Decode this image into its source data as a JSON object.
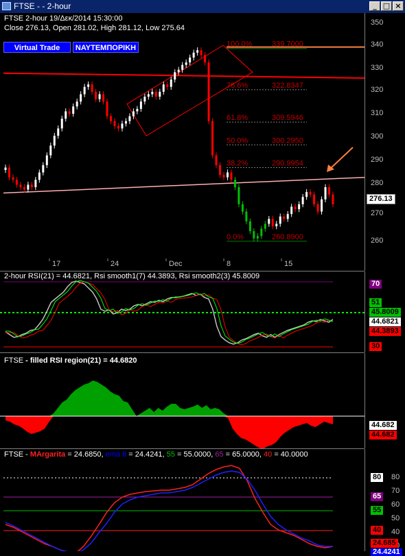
{
  "window": {
    "title": "FTSE -  - 2-hour",
    "min_label": "_",
    "max_label": "□",
    "close_label": "×"
  },
  "main_pane": {
    "header_line1": "FTSE  2-hour  19/Δεκ/2014 15:30:00",
    "header_line2": "Close 276.13, Open 281.02, High 281.12, Low 275.64",
    "buttons": [
      "Virtual Trade",
      "ΝΑΥΤΕΜΠΟΡΙΚΗ"
    ],
    "price_ticks": [
      "350",
      "340",
      "330",
      "320",
      "310",
      "300",
      "290",
      "280",
      "270",
      "260"
    ],
    "last_price": "276.13",
    "fib_levels": [
      {
        "pct": "100.0%",
        "value": "339.7000"
      },
      {
        "pct": "78.6%",
        "value": "322.8347"
      },
      {
        "pct": "61.8%",
        "value": "309.5946"
      },
      {
        "pct": "50.0%",
        "value": "300.2950"
      },
      {
        "pct": "38.2%",
        "value": "290.9954"
      },
      {
        "pct": "0.0%",
        "value": "260.8900"
      }
    ],
    "date_labels": [
      "17",
      "24",
      "Dec",
      "8",
      "15"
    ],
    "colors": {
      "up": "#ffffff",
      "down": "#ff0000",
      "fib": "#c00000",
      "channel": "#ff0000",
      "support": "#ffb0b0",
      "arrow": "#ff8040",
      "top_line": "#ff8040"
    }
  },
  "rsi_pane": {
    "header": "2-hour RSI(21) = 44.6821, Rsi smooth1(7) 44.3893, Rsi smooth2(3) 45.8009",
    "badges": [
      {
        "text": "70",
        "bg": "#800080",
        "fg": "#ffffff"
      },
      {
        "text": "51",
        "bg": "#00c000",
        "fg": "#000000"
      },
      {
        "text": "45.8009",
        "bg": "#00c000",
        "fg": "#000000"
      },
      {
        "text": "44.6821",
        "bg": "#ffffff",
        "fg": "#000000"
      },
      {
        "text": "44.3893",
        "bg": "#ff0000",
        "fg": "#000000"
      },
      {
        "text": "30",
        "bg": "#ff0000",
        "fg": "#000000"
      }
    ]
  },
  "filled_pane": {
    "header_name": "FTSE",
    "header_rest": " - filled RSI region(21) = 44.6820",
    "badges": [
      {
        "text": "44.682",
        "bg": "#ffffff",
        "fg": "#000000"
      },
      {
        "text": "44.682",
        "bg": "#ff0000",
        "fg": "#000000"
      }
    ]
  },
  "margarita_pane": {
    "header_parts": [
      {
        "text": "FTSE",
        "color": "#ffffff"
      },
      {
        "text": " - ",
        "color": "#ffffff"
      },
      {
        "text": "MArgarita",
        "color": "#ff2020"
      },
      {
        "text": " = 24.6850, ",
        "color": "#ffffff"
      },
      {
        "text": "ema 8",
        "color": "#0000ff"
      },
      {
        "text": " = 24.4241, ",
        "color": "#ffffff"
      },
      {
        "text": "55",
        "color": "#00c000"
      },
      {
        "text": " = 55.0000, ",
        "color": "#ffffff"
      },
      {
        "text": "65",
        "color": "#a020a0"
      },
      {
        "text": " = 65.0000, ",
        "color": "#ffffff"
      },
      {
        "text": "40",
        "color": "#ff2020"
      },
      {
        "text": " = 40.0000",
        "color": "#ffffff"
      }
    ],
    "ticks": [
      "80",
      "70",
      "60",
      "50",
      "40",
      "30"
    ],
    "badges": [
      {
        "text": "80",
        "bg": "#ffffff",
        "fg": "#000000"
      },
      {
        "text": "65",
        "bg": "#800080",
        "fg": "#ffffff"
      },
      {
        "text": "55",
        "bg": "#00c000",
        "fg": "#000000"
      },
      {
        "text": "40",
        "bg": "#ff0000",
        "fg": "#000000"
      },
      {
        "text": "24.685",
        "bg": "#ff0000",
        "fg": "#000000"
      },
      {
        "text": "24.4241",
        "bg": "#0000ff",
        "fg": "#ffffff"
      }
    ]
  }
}
